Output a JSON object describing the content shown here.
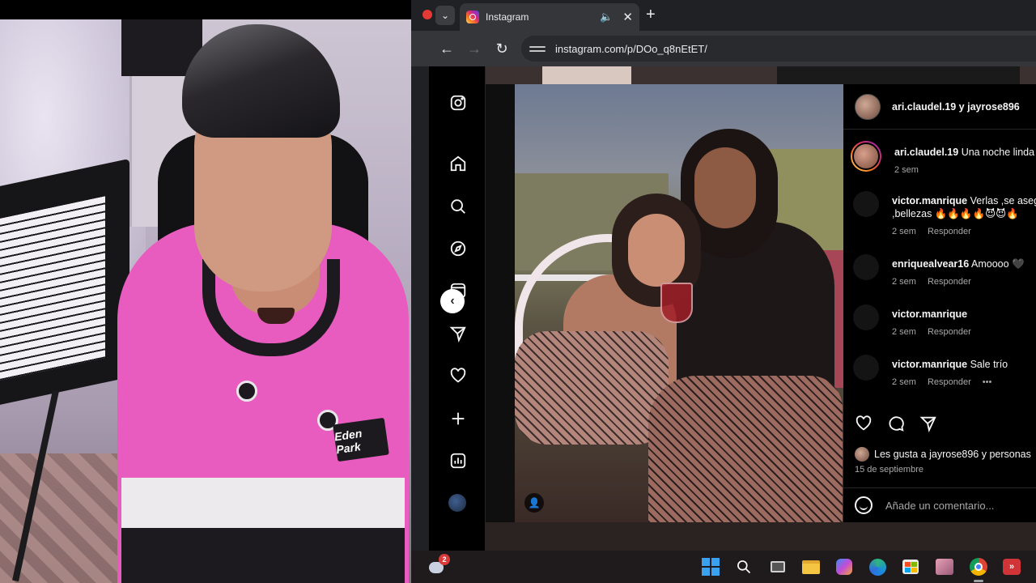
{
  "browser": {
    "tab_title": "Instagram",
    "url": "instagram.com/p/DOo_q8nEtET/"
  },
  "post": {
    "header_names": "ari.claudel.19 y jayrose896",
    "comments": [
      {
        "user": "ari.claudel.19",
        "text": "Una noche linda",
        "time": "2 sem",
        "reply": ""
      },
      {
        "user": "victor.manrique",
        "text": "Verlas ,se aseg",
        "text_line2": ",bellezas 🔥🔥🔥🔥😈😈🔥",
        "time": "2 sem",
        "reply": "Responder"
      },
      {
        "user": "enriquealvear16",
        "text": "Amoooo 🖤",
        "time": "2 sem",
        "reply": "Responder"
      },
      {
        "user": "victor.manrique",
        "text": "",
        "time": "2 sem",
        "reply": "Responder"
      },
      {
        "user": "victor.manrique",
        "text": "Sale trío",
        "time": "2 sem",
        "reply": "Responder"
      }
    ],
    "more_options": "•••",
    "likes_text": "Les gusta a jayrose896 y personas",
    "date": "15 de septiembre",
    "add_comment_placeholder": "Añade un comentario..."
  },
  "webcam": {
    "shirt_badge": "Eden Park"
  },
  "taskbar": {
    "weather_badge": "2",
    "icons": [
      "widgets-icon",
      "start-icon",
      "search-icon",
      "task-view-icon",
      "file-explorer-icon",
      "copilot-icon",
      "edge-icon",
      "store-icon",
      "photos-icon",
      "chrome-icon",
      "app-icon"
    ]
  }
}
